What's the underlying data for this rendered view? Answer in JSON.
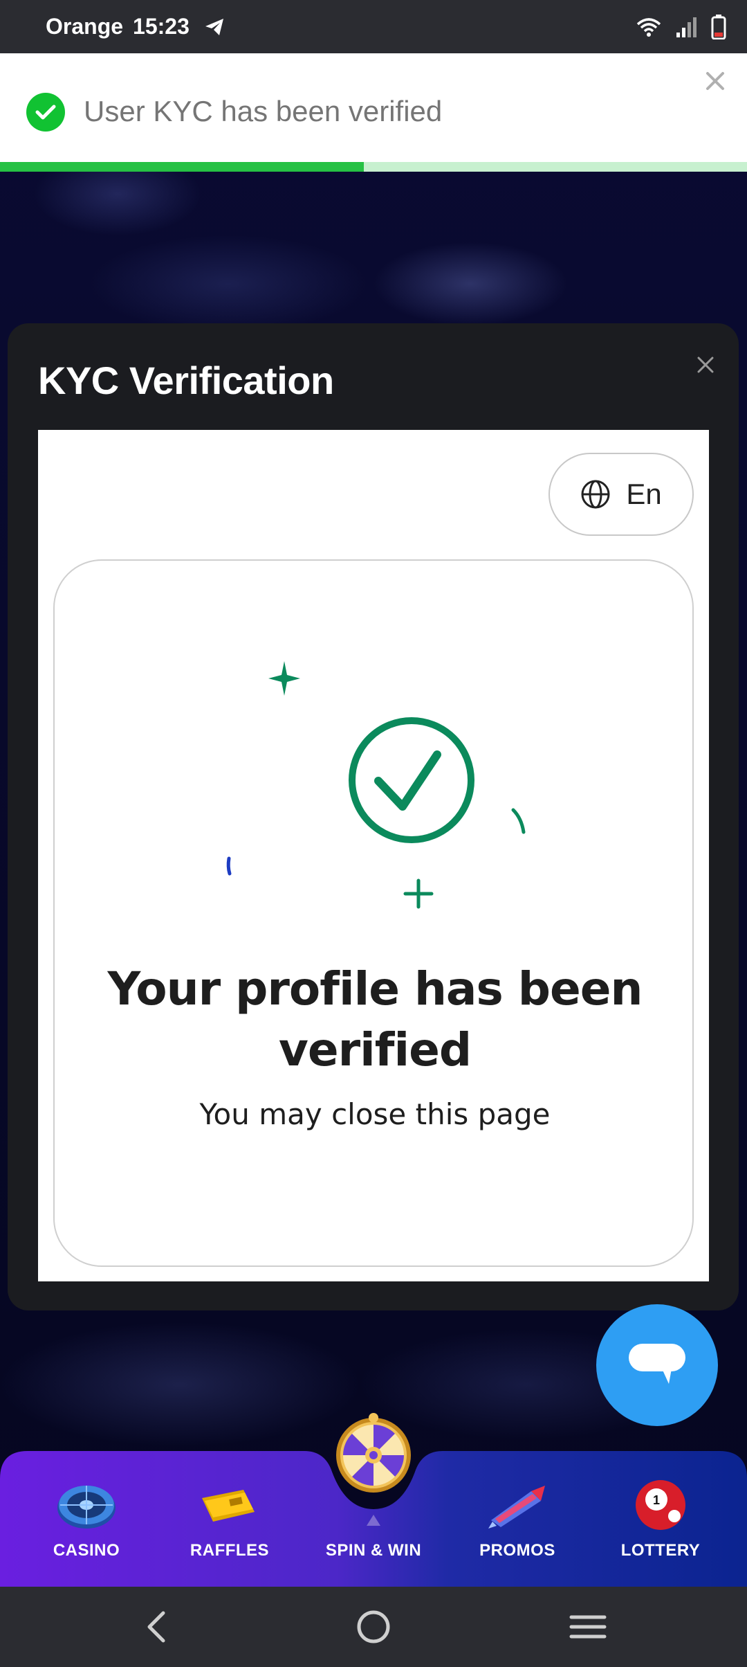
{
  "status_bar": {
    "carrier": "Orange",
    "time": "15:23"
  },
  "toast": {
    "message": "User KYC has been verified",
    "progress": 0.487,
    "colors": {
      "success": "#11c232",
      "track": "#c7f0cf"
    }
  },
  "modal": {
    "title": "KYC Verification",
    "language_button": "En",
    "headline": "Your profile has been verified",
    "subtext": "You may close this page",
    "colors": {
      "check": "#0b8a5c"
    }
  },
  "bottom_nav": {
    "items": [
      {
        "label": "CASINO",
        "icon": "roulette-icon"
      },
      {
        "label": "RAFFLES",
        "icon": "ticket-icon"
      },
      {
        "label": "SPIN & WIN",
        "icon": "wheel-icon"
      },
      {
        "label": "PROMOS",
        "icon": "rocket-icon"
      },
      {
        "label": "LOTTERY",
        "icon": "lottery-ball-icon"
      }
    ],
    "colors": {
      "left": "#6a1fe0",
      "right": "#0b2490"
    }
  },
  "chat": {
    "icon": "chat-bubble-icon",
    "color": "#2e9ef3"
  }
}
